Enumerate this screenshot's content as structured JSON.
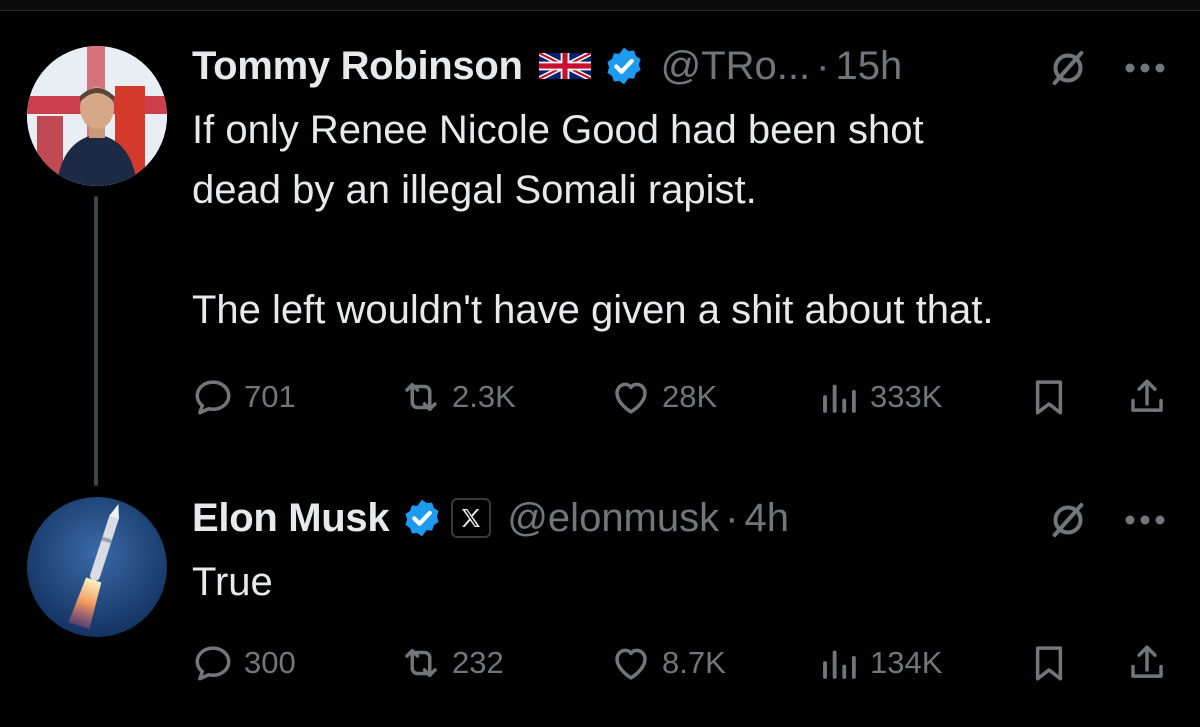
{
  "thread": {
    "parent": {
      "author_name": "Tommy Robinson",
      "handle": "@TRo...",
      "separator": "·",
      "time": "15h",
      "text_lines": [
        "If only Renee Nicole Good had been shot\ndead by an illegal Somali rapist.",
        "The left wouldn't have given a shit about that."
      ],
      "replies": "701",
      "reposts": "2.3K",
      "likes": "28K",
      "views": "333K",
      "flag_icon": "uk-flag-icon",
      "badge_icon": "verified-badge-icon"
    },
    "reply": {
      "author_name": "Elon Musk",
      "handle": "@elonmusk",
      "separator": "·",
      "time": "4h",
      "text": "True",
      "replies": "300",
      "reposts": "232",
      "likes": "8.7K",
      "views": "134K",
      "badge_icon": "verified-badge-icon",
      "affiliation_icon": "x-logo-icon"
    }
  },
  "colors": {
    "background": "#000000",
    "text_primary": "#e7e9ea",
    "text_secondary": "#71767b",
    "verified_blue": "#1d9bf0",
    "thread_line": "#3f4448"
  }
}
